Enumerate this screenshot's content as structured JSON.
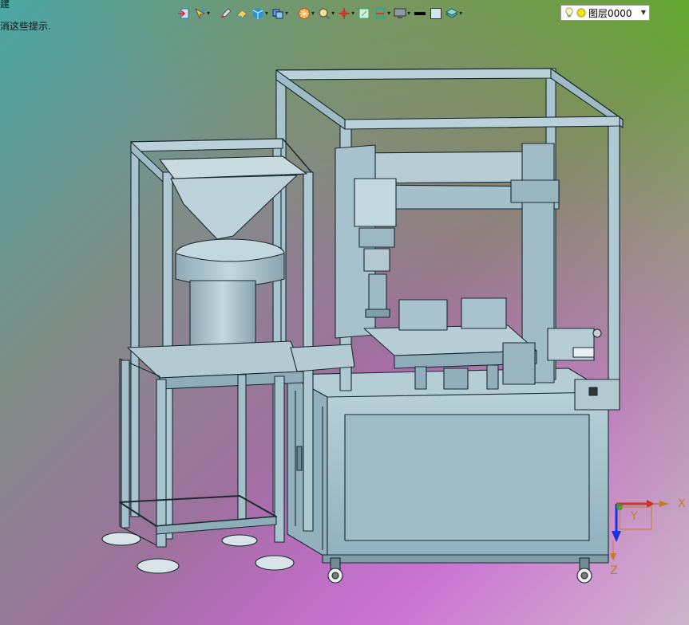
{
  "hint": {
    "line1": "建",
    "line2": "消这些提示."
  },
  "toolbar": {
    "buttons": [
      {
        "id": "import",
        "icon": "import-arrow-icon",
        "dropdown": false
      },
      {
        "id": "pick",
        "icon": "pick-filter-icon",
        "dropdown": true
      },
      {
        "id": "pen",
        "icon": "pen-icon",
        "dropdown": false
      },
      {
        "id": "eraser",
        "icon": "eraser-icon",
        "dropdown": false
      },
      {
        "id": "cube",
        "icon": "solid-cube-icon",
        "dropdown": true
      },
      {
        "id": "view",
        "icon": "view-cube-icon",
        "dropdown": true
      },
      {
        "id": "render",
        "icon": "render-sphere-icon",
        "dropdown": true
      },
      {
        "id": "zoom",
        "icon": "zoom-icon",
        "dropdown": true
      },
      {
        "id": "axis",
        "icon": "axis-pivot-icon",
        "dropdown": true
      },
      {
        "id": "frame",
        "icon": "frame-icon",
        "dropdown": false
      },
      {
        "id": "section",
        "icon": "section-icon",
        "dropdown": true
      },
      {
        "id": "display",
        "icon": "monitor-icon",
        "dropdown": true
      },
      {
        "id": "line",
        "icon": "line-weight-icon",
        "dropdown": false
      },
      {
        "id": "color",
        "icon": "color-swatch-icon",
        "dropdown": false
      },
      {
        "id": "layer-tools",
        "icon": "layer-stack-icon",
        "dropdown": true
      }
    ]
  },
  "layer": {
    "label": "图层0000",
    "icons": [
      "lightbulb-icon",
      "sun-icon"
    ]
  },
  "triad": {
    "x_label": "X",
    "y_label": "Y",
    "z_label": "Z"
  },
  "colors": {
    "bg_top_right": "#5fa52a",
    "bg_left": "#4aa7a3",
    "bg_bottom_left": "#e74bd8",
    "bg_bottom_right": "#c8c8c8",
    "model_fill": "#a6c2cc",
    "model_edge": "#1a2a30",
    "axis_x": "#e02020",
    "axis_y": "#2fa02f",
    "axis_z": "#2030e0"
  }
}
